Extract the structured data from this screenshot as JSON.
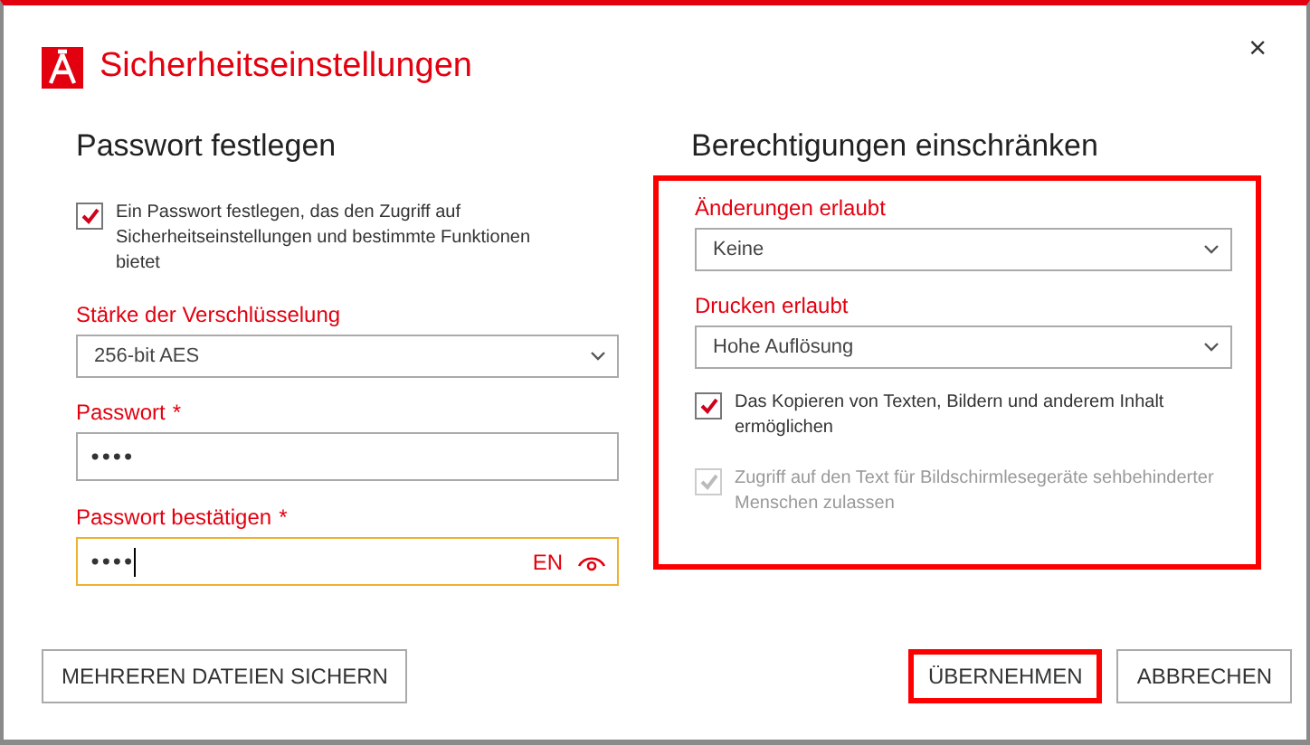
{
  "window": {
    "title": "Sicherheitseinstellungen",
    "close": "×"
  },
  "password_section": {
    "heading": "Passwort festlegen",
    "set_password": {
      "label": "Ein Passwort festlegen, das den Zugriff auf Sicherheitseinstellungen und bestimmte Funktionen bietet",
      "checked": true
    },
    "encryption": {
      "label": "Stärke der Verschlüsselung",
      "value": "256-bit AES"
    },
    "password": {
      "label": "Passwort",
      "required": "*",
      "value": "••••",
      "focused": false
    },
    "confirm": {
      "label": "Passwort bestätigen",
      "required": "*",
      "value": "••••",
      "focused": true,
      "language": "EN"
    }
  },
  "permissions_section": {
    "heading": "Berechtigungen einschränken",
    "highlighted": true,
    "changes": {
      "label": "Änderungen erlaubt",
      "value": "Keine"
    },
    "printing": {
      "label": "Drucken erlaubt",
      "value": "Hohe Auflösung"
    },
    "options": [
      {
        "label": "Das Kopieren von Texten, Bildern und anderem Inhalt ermöglichen",
        "checked": true,
        "disabled": false
      },
      {
        "label": "Zugriff auf den Text für Bildschirmlesegeräte sehbehinderter Menschen zulassen",
        "checked": true,
        "disabled": true
      }
    ]
  },
  "buttons": [
    {
      "label": "MEHREREN DATEIEN SICHERN",
      "highlighted": false
    },
    {
      "label": "ÜBERNEHMEN",
      "highlighted": true
    },
    {
      "label": "ABBRECHEN",
      "highlighted": false
    }
  ]
}
